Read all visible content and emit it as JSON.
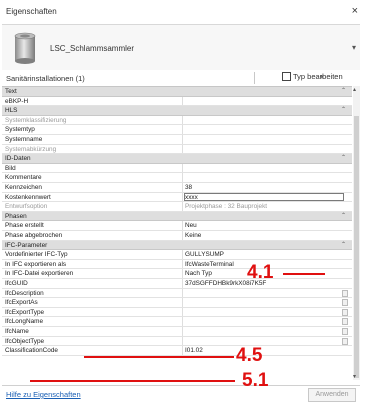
{
  "window": {
    "title": "Eigenschaften",
    "close": "×"
  },
  "type_selector": {
    "name": "LSC_Schlammsammler",
    "dropdown": "▾"
  },
  "selection": {
    "label": "Sanitärinstallationen (1)",
    "dropdown": "▾",
    "edit_type_label": "Typ bearbeiten"
  },
  "rows": [
    {
      "kind": "group",
      "key": "Text"
    },
    {
      "kind": "prop",
      "key": "eBKP-H",
      "value": ""
    },
    {
      "kind": "group",
      "key": "HLS"
    },
    {
      "kind": "prop",
      "key": "Systemklassifizierung",
      "value": "",
      "greyed": true
    },
    {
      "kind": "prop",
      "key": "Systemtyp",
      "value": ""
    },
    {
      "kind": "prop",
      "key": "Systemname",
      "value": ""
    },
    {
      "kind": "prop",
      "key": "Systemabkürzung",
      "value": "",
      "greyed": true
    },
    {
      "kind": "group",
      "key": "ID-Daten"
    },
    {
      "kind": "prop",
      "key": "Bild",
      "value": ""
    },
    {
      "kind": "prop",
      "key": "Kommentare",
      "value": ""
    },
    {
      "kind": "prop",
      "key": "Kennzeichen",
      "value": "38"
    },
    {
      "kind": "prop",
      "key": "Kostenkennwert",
      "value": "xxxx",
      "input": true
    },
    {
      "kind": "prop",
      "key": "Entwurfsoption",
      "value": "Projektphase : 32 Bauprojekt",
      "greyed": true
    },
    {
      "kind": "group",
      "key": "Phasen"
    },
    {
      "kind": "prop",
      "key": "Phase erstellt",
      "value": "Neu"
    },
    {
      "kind": "prop",
      "key": "Phase abgebrochen",
      "value": "Keine"
    },
    {
      "kind": "group",
      "key": "IFC-Parameter"
    },
    {
      "kind": "prop",
      "key": "Vordefinierter IFC-Typ",
      "value": "GULLYSUMP"
    },
    {
      "kind": "prop",
      "key": "In IFC exportieren als",
      "value": "IfcWasteTerminal"
    },
    {
      "kind": "prop",
      "key": "In IFC-Datei exportieren",
      "value": "Nach Typ"
    },
    {
      "kind": "prop",
      "key": "IfcGUID",
      "value": "37dSGFFDHBk9rkX08i7K5F"
    },
    {
      "kind": "prop",
      "key": "IfcDescription",
      "value": "",
      "stepper": true
    },
    {
      "kind": "prop",
      "key": "IfcExportAs",
      "value": "",
      "stepper": true
    },
    {
      "kind": "prop",
      "key": "IfcExportType",
      "value": "",
      "stepper": true
    },
    {
      "kind": "prop",
      "key": "IfcLongName",
      "value": "",
      "stepper": true
    },
    {
      "kind": "prop",
      "key": "IfcName",
      "value": "",
      "stepper": true
    },
    {
      "kind": "prop",
      "key": "IfcObjectType",
      "value": "",
      "stepper": true
    },
    {
      "kind": "prop",
      "key": "ClassificationCode",
      "value": "I01.02"
    }
  ],
  "scrollbar": {
    "up": "▴",
    "down": "▾"
  },
  "footer": {
    "help_link": "Hilfe zu Eigenschaften",
    "apply_label": "Anwenden"
  },
  "annotations": [
    {
      "label": "4.1",
      "color": "#e01010"
    },
    {
      "label": "4.5",
      "color": "#e01010"
    },
    {
      "label": "5.1",
      "color": "#e01010"
    }
  ]
}
